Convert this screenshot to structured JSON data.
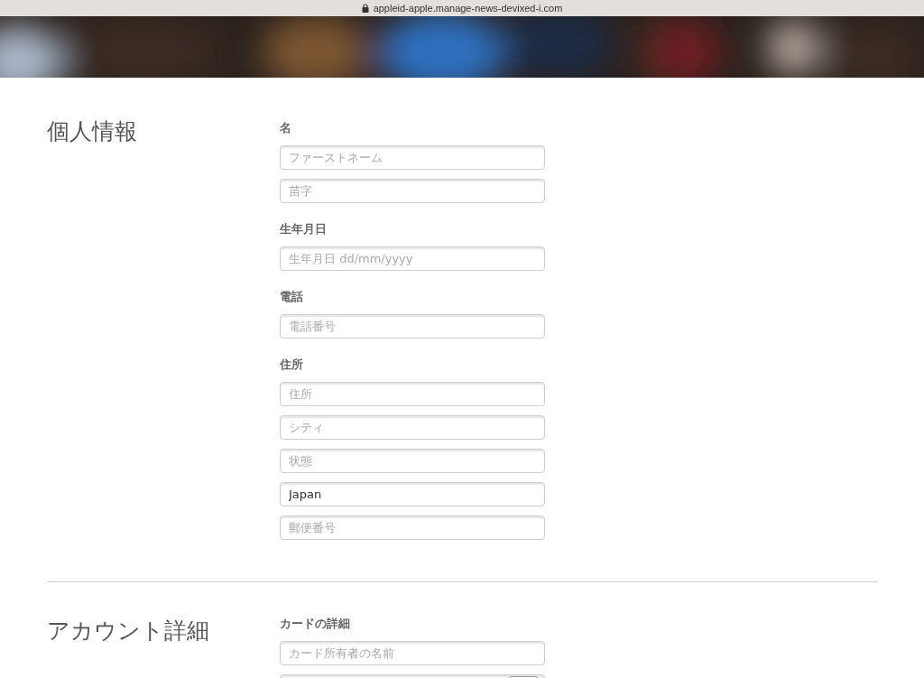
{
  "browser_bar": {
    "url": "appleid-apple.manage-news-devixed-i.com"
  },
  "sections": [
    {
      "title": "個人情報",
      "groups": [
        {
          "label": "名",
          "fields": [
            {
              "kind": "text",
              "placeholder": "ファーストネーム"
            },
            {
              "kind": "text",
              "placeholder": "苗字"
            }
          ]
        },
        {
          "label": "生年月日",
          "fields": [
            {
              "kind": "text",
              "placeholder": "生年月日 dd/mm/yyyy"
            }
          ]
        },
        {
          "label": "電話",
          "fields": [
            {
              "kind": "text",
              "placeholder": "電話番号"
            }
          ]
        },
        {
          "label": "住所",
          "fields": [
            {
              "kind": "text",
              "placeholder": "住所"
            },
            {
              "kind": "text",
              "placeholder": "シティ"
            },
            {
              "kind": "text",
              "placeholder": "状態"
            },
            {
              "kind": "text",
              "value": "Japan"
            },
            {
              "kind": "text",
              "placeholder": "郵便番号"
            }
          ]
        }
      ]
    },
    {
      "title": "アカウント詳細",
      "groups": [
        {
          "label": "カードの詳細",
          "fields": [
            {
              "kind": "text",
              "placeholder": "カード所有者の名前"
            },
            {
              "kind": "card"
            }
          ]
        }
      ]
    }
  ]
}
